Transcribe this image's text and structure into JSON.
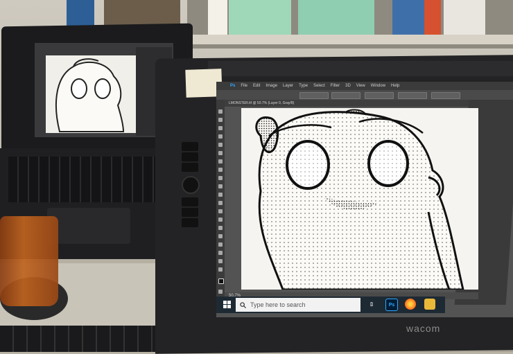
{
  "photoshop": {
    "menu": [
      "Ps",
      "File",
      "Edit",
      "Image",
      "Layer",
      "Type",
      "Select",
      "Filter",
      "3D",
      "View",
      "Window",
      "Help"
    ],
    "tab_title": "LMONSTER.tif @ 50.7% (Layer 0, Gray/8)",
    "zoom": "50.7%"
  },
  "taskbar": {
    "search_placeholder": "Type here to search",
    "photoshop_label": "Ps"
  },
  "tablet": {
    "brand": "wacom"
  },
  "colors": {
    "taskbar": "#1e2a33",
    "photoshop_bg": "#535353",
    "photoshop_accent": "#31a8ff"
  }
}
